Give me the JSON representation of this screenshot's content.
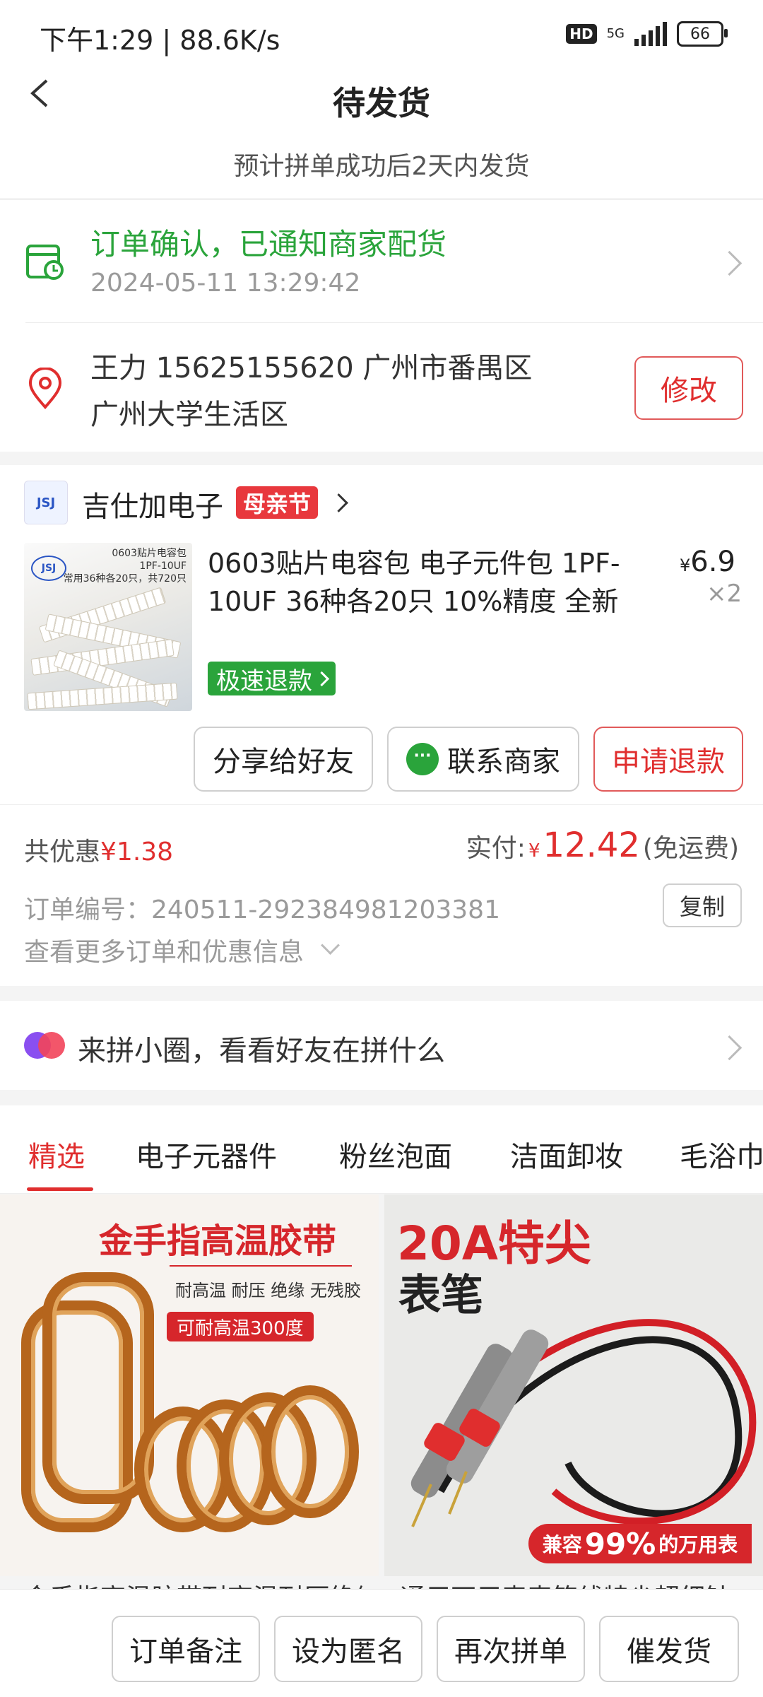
{
  "status_bar": {
    "time": "下午1:29 | 88.6K/s",
    "hd": "HD",
    "network": "5G",
    "battery": "66"
  },
  "header": {
    "title": "待发货",
    "subtitle": "预计拼单成功后2天内发货"
  },
  "order_status": {
    "title": "订单确认，已通知商家配货",
    "time": "2024-05-11 13:29:42"
  },
  "address": {
    "line1": "王力  15625155620  广州市番禺区",
    "line2": "广州大学生活区",
    "edit_label": "修改"
  },
  "shop": {
    "name": "吉仕加电子",
    "festival_tag": "母亲节",
    "logo_text": "JSJ"
  },
  "product": {
    "title": "0603贴片电容包 电子元件包 1PF-10UF 36种各20只 10%精度 全新",
    "price_symbol": "¥",
    "price": "6.9",
    "quantity": "×2",
    "fast_refund": "极速退款",
    "thumb_label": "0603贴片电容包\n1PF-10UF\n常用36种各20只，共720只",
    "thumb_logo": "JSJ"
  },
  "actions": {
    "share": "分享给好友",
    "contact": "联系商家",
    "refund": "申请退款"
  },
  "summary": {
    "discount_label": "共优惠",
    "discount_value": "¥1.38",
    "paid_label": "实付:",
    "paid_symbol": "¥",
    "paid_amount": "12.42",
    "shipping_note": "(免运费)",
    "order_no": "订单编号：240511-292384981203381",
    "copy_label": "复制",
    "more_info": "查看更多订单和优惠信息"
  },
  "circle": {
    "text": "来拼小圈，看看好友在拼什么"
  },
  "tabs": [
    "精选",
    "电子元器件",
    "粉丝泡面",
    "洁面卸妆",
    "毛浴巾"
  ],
  "recommendations": [
    {
      "title": "金手指高温胶带",
      "subtitle": "耐高温 耐压 绝缘 无残胶",
      "badge": "可耐高温300度",
      "caption": "金手指高温胶带耐高温耐压绝缘"
    },
    {
      "title": "20A特尖",
      "subtitle": "表笔",
      "badge_pre": "兼容",
      "badge_num": "99%",
      "badge_post": "的万用表",
      "caption": "通用万用表表笔线特尖超细针"
    }
  ],
  "bottom_actions": [
    "订单备注",
    "设为匿名",
    "再次拼单",
    "催发货"
  ],
  "colors": {
    "accent_red": "#e02e2e",
    "status_green": "#2aa43b",
    "background": "#f4f4f4"
  }
}
